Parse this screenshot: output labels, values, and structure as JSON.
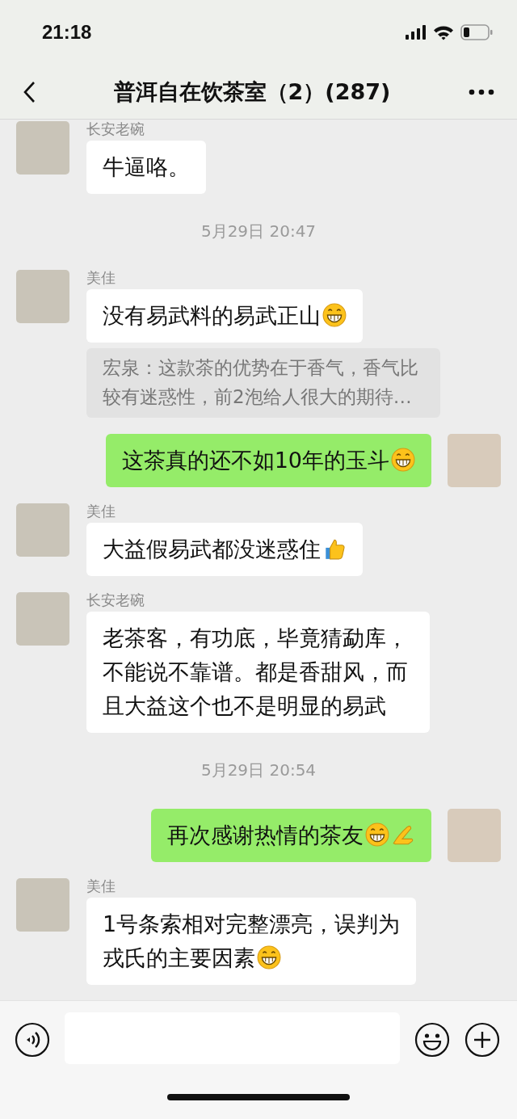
{
  "status_bar": {
    "time": "21:18"
  },
  "header": {
    "title": "普洱自在饮茶室（2）(287)"
  },
  "messages": [
    {
      "kind": "received",
      "sender": "长安老碗",
      "text": "牛逼咯。"
    },
    {
      "kind": "time",
      "text": "5月29日 20:47"
    },
    {
      "kind": "received",
      "sender": "美佳",
      "text": "没有易武料的易武正山",
      "emojis": [
        {
          "kind": "grin"
        }
      ]
    },
    {
      "kind": "quote",
      "text": "宏泉：这款茶的优势在于香气，香气比较有迷惑性，前2泡给人很大的期待…"
    },
    {
      "kind": "sent",
      "text": "这茶真的还不如10年的玉斗",
      "emojis": [
        {
          "kind": "grin"
        }
      ]
    },
    {
      "kind": "received",
      "sender": "美佳",
      "text": "大益假易武都没迷惑住",
      "emojis": [
        {
          "kind": "thumbsup"
        }
      ]
    },
    {
      "kind": "received",
      "sender": "长安老碗",
      "text": "老茶客，有功底，毕竟猜勐库，不能说不靠谱。都是香甜风，而且大益这个也不是明显的易武"
    },
    {
      "kind": "time",
      "text": "5月29日 20:54"
    },
    {
      "kind": "sent",
      "text": "再次感谢热情的茶友",
      "emojis": [
        {
          "kind": "grin"
        },
        {
          "kind": "pinch"
        }
      ]
    },
    {
      "kind": "received",
      "sender": "美佳",
      "lines": [
        "1号条索相对完整漂亮，误判为",
        "戎氏的主要因素"
      ],
      "emojis": [
        {
          "kind": "grin"
        }
      ]
    }
  ]
}
